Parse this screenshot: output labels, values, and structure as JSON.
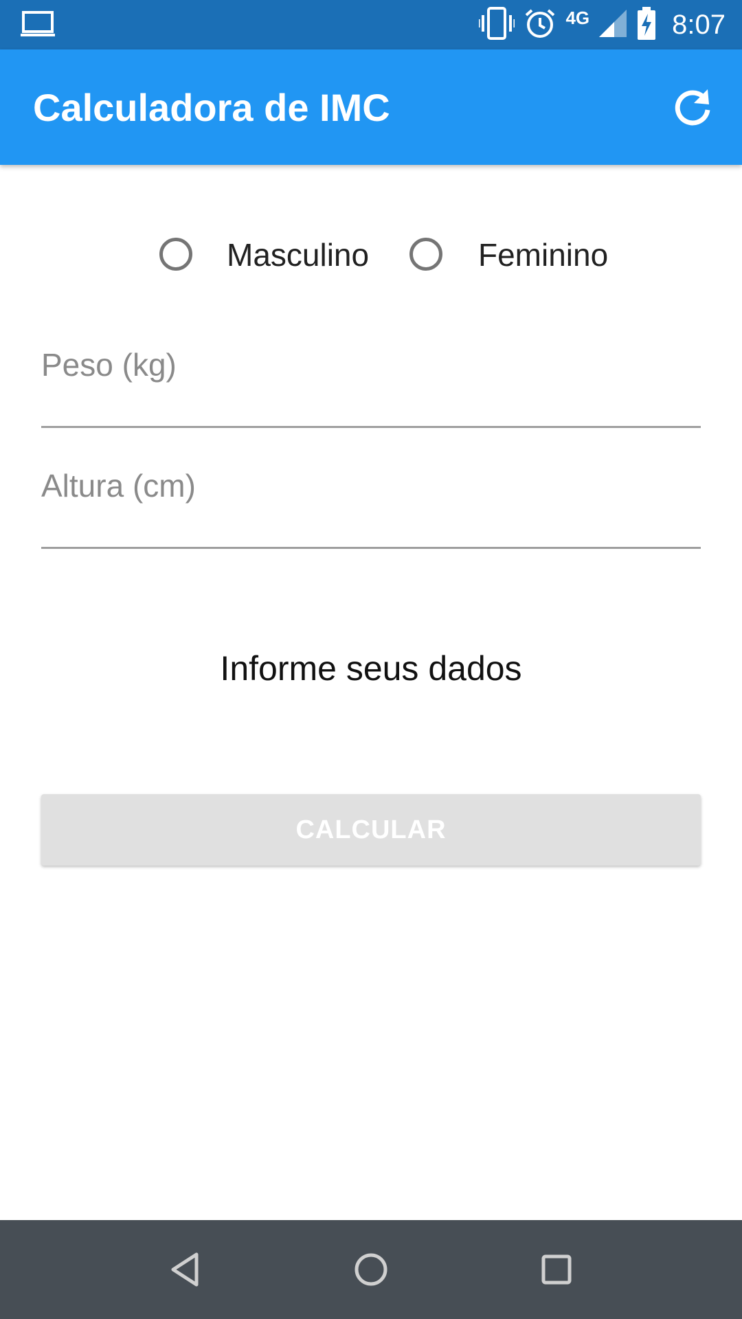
{
  "status_bar": {
    "time": "8:07",
    "network": "4G",
    "icons": [
      "laptop-icon",
      "vibrate-icon",
      "alarm-icon",
      "signal-icon",
      "battery-charging-icon"
    ]
  },
  "app_bar": {
    "title": "Calculadora de IMC",
    "refresh_icon": "refresh-icon"
  },
  "gender": {
    "options": [
      "Masculino",
      "Feminino"
    ],
    "selected": null
  },
  "form": {
    "weight_placeholder": "Peso (kg)",
    "height_placeholder": "Altura (cm)"
  },
  "info_text": "Informe seus dados",
  "calculate_button": "CALCULAR",
  "nav_bar": {
    "icons": [
      "back-icon",
      "home-icon",
      "recents-icon"
    ]
  },
  "colors": {
    "status_bar": "#1b6fb6",
    "app_bar": "#2196f3",
    "button_disabled": "#e0e0e0",
    "nav_bar": "#474e55"
  }
}
